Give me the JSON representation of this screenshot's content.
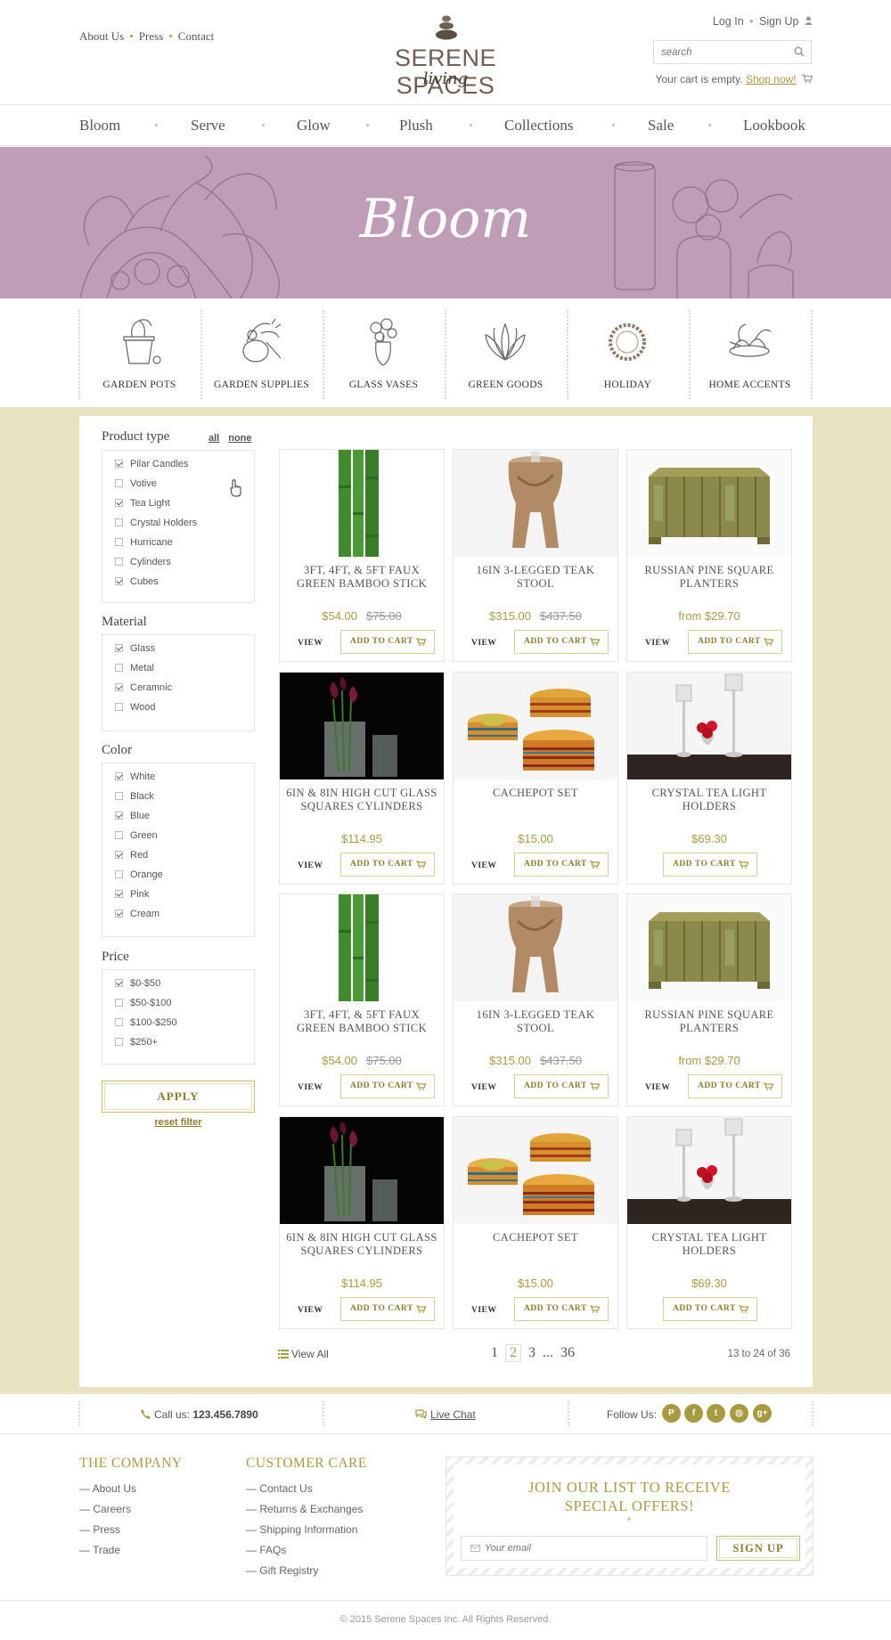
{
  "header": {
    "top_links": [
      "About Us",
      "Press",
      "Contact"
    ],
    "logo_name": "SERENE SPACES",
    "logo_sub": "living",
    "login": "Log In",
    "signup": "Sign Up",
    "search_placeholder": "search",
    "cart_text": "Your cart is empty.",
    "cart_link": "Shop now!"
  },
  "nav": [
    "Bloom",
    "Serve",
    "Glow",
    "Plush",
    "Collections",
    "Sale",
    "Lookbook"
  ],
  "banner": {
    "title": "Bloom"
  },
  "categories": [
    "GARDEN POTS",
    "GARDEN SUPPLIES",
    "GLASS VASES",
    "GREEN GOODS",
    "HOLIDAY",
    "HOME ACCENTS"
  ],
  "filters": {
    "product_type": {
      "label": "Product type",
      "all": "all",
      "none": "none",
      "options": [
        {
          "label": "Pilar Candles",
          "checked": true
        },
        {
          "label": "Votive",
          "checked": false
        },
        {
          "label": "Tea Light",
          "checked": true
        },
        {
          "label": "Crystal Holders",
          "checked": false
        },
        {
          "label": "Hurricane",
          "checked": false
        },
        {
          "label": "Cylinders",
          "checked": false
        },
        {
          "label": "Cubes",
          "checked": true
        }
      ]
    },
    "material": {
      "label": "Material",
      "options": [
        {
          "label": "Glass",
          "checked": true
        },
        {
          "label": "Metal",
          "checked": false
        },
        {
          "label": "Ceramnic",
          "checked": true
        },
        {
          "label": "Wood",
          "checked": false
        }
      ]
    },
    "color": {
      "label": "Color",
      "options": [
        {
          "label": "White",
          "checked": true
        },
        {
          "label": "Black",
          "checked": false
        },
        {
          "label": "Blue",
          "checked": true
        },
        {
          "label": "Green",
          "checked": false
        },
        {
          "label": "Red",
          "checked": true
        },
        {
          "label": "Orange",
          "checked": false
        },
        {
          "label": "Pink",
          "checked": true
        },
        {
          "label": "Cream",
          "checked": true
        }
      ]
    },
    "price": {
      "label": "Price",
      "options": [
        {
          "label": "$0-$50",
          "checked": true
        },
        {
          "label": "$50-$100",
          "checked": false
        },
        {
          "label": "$100-$250",
          "checked": false
        },
        {
          "label": "$250+",
          "checked": false
        }
      ]
    },
    "apply": "APPLY",
    "reset": "reset filter"
  },
  "products": [
    {
      "title": "3FT, 4FT, & 5FT FAUX GREEN BAMBOO STICK",
      "price": "$54.00",
      "old_price": "$75.00",
      "image": "bamboo",
      "view": "VIEW",
      "add": "ADD TO CART"
    },
    {
      "title": "16IN 3-LEGGED TEAK STOOL",
      "price": "$315.00",
      "old_price": "$437.50",
      "image": "stool",
      "view": "VIEW",
      "add": "ADD TO CART"
    },
    {
      "title": "RUSSIAN PINE SQUARE PLANTERS",
      "price": "from $29.70",
      "old_price": "",
      "image": "planter",
      "view": "VIEW",
      "add": "ADD TO CART"
    },
    {
      "title": "6IN & 8IN HIGH CUT GLASS SQUARES CYLINDERS",
      "price": "$114.95",
      "old_price": "",
      "image": "vase",
      "view": "VIEW",
      "add": "ADD TO CART"
    },
    {
      "title": "CACHEPOT SET",
      "price": "$15.00",
      "old_price": "",
      "image": "baskets",
      "view": "VIEW",
      "add": "ADD TO CART"
    },
    {
      "title": "CRYSTAL TEA LIGHT HOLDERS",
      "price": "$69.30",
      "old_price": "",
      "image": "candles",
      "view": "",
      "add": "ADD TO CART"
    },
    {
      "title": "3FT, 4FT, & 5FT FAUX GREEN BAMBOO STICK",
      "price": "$54.00",
      "old_price": "$75.00",
      "image": "bamboo",
      "view": "VIEW",
      "add": "ADD TO CART"
    },
    {
      "title": "16IN 3-LEGGED TEAK STOOL",
      "price": "$315.00",
      "old_price": "$437.50",
      "image": "stool",
      "view": "VIEW",
      "add": "ADD TO CART"
    },
    {
      "title": "RUSSIAN PINE SQUARE PLANTERS",
      "price": "from $29.70",
      "old_price": "",
      "image": "planter",
      "view": "VIEW",
      "add": "ADD TO CART"
    },
    {
      "title": "6IN & 8IN HIGH CUT GLASS SQUARES CYLINDERS",
      "price": "$114.95",
      "old_price": "",
      "image": "vase",
      "view": "VIEW",
      "add": "ADD TO CART"
    },
    {
      "title": "CACHEPOT SET",
      "price": "$15.00",
      "old_price": "",
      "image": "baskets",
      "view": "VIEW",
      "add": "ADD TO CART"
    },
    {
      "title": "CRYSTAL TEA LIGHT HOLDERS",
      "price": "$69.30",
      "old_price": "",
      "image": "candles",
      "view": "",
      "add": "ADD TO CART"
    }
  ],
  "pagination": {
    "view_all": "View All",
    "pages": [
      "1",
      "2",
      "3",
      "...",
      "36"
    ],
    "current": "2",
    "count": "13 to 24 of 36"
  },
  "contact": {
    "call_label": "Call us:",
    "phone": "123.456.7890",
    "chat": "Live Chat",
    "follow": "Follow Us:",
    "social": [
      "pinterest-icon",
      "facebook-icon",
      "twitter-icon",
      "instagram-icon",
      "google-plus-icon"
    ]
  },
  "footer": {
    "company": {
      "title": "THE COMPANY",
      "links": [
        "— About Us",
        "— Careers",
        "— Press",
        "— Trade"
      ]
    },
    "care": {
      "title": "CUSTOMER CARE",
      "links": [
        "— Contact Us",
        "— Returns & Exchanges",
        "— Shipping Information",
        "— FAQs",
        "— Gift Registry"
      ]
    },
    "newsletter": {
      "title_line1": "JOIN OUR LIST TO RECEIVE",
      "title_line2": "SPECIAL OFFERS!",
      "placeholder": "Your email",
      "button": "SIGN UP"
    },
    "copyright": "© 2015 Serene Spaces Inc. All Rights Reserved."
  },
  "colors": {
    "accent": "#a89b3f",
    "banner": "#c09db7",
    "background": "#e8e2c0"
  }
}
